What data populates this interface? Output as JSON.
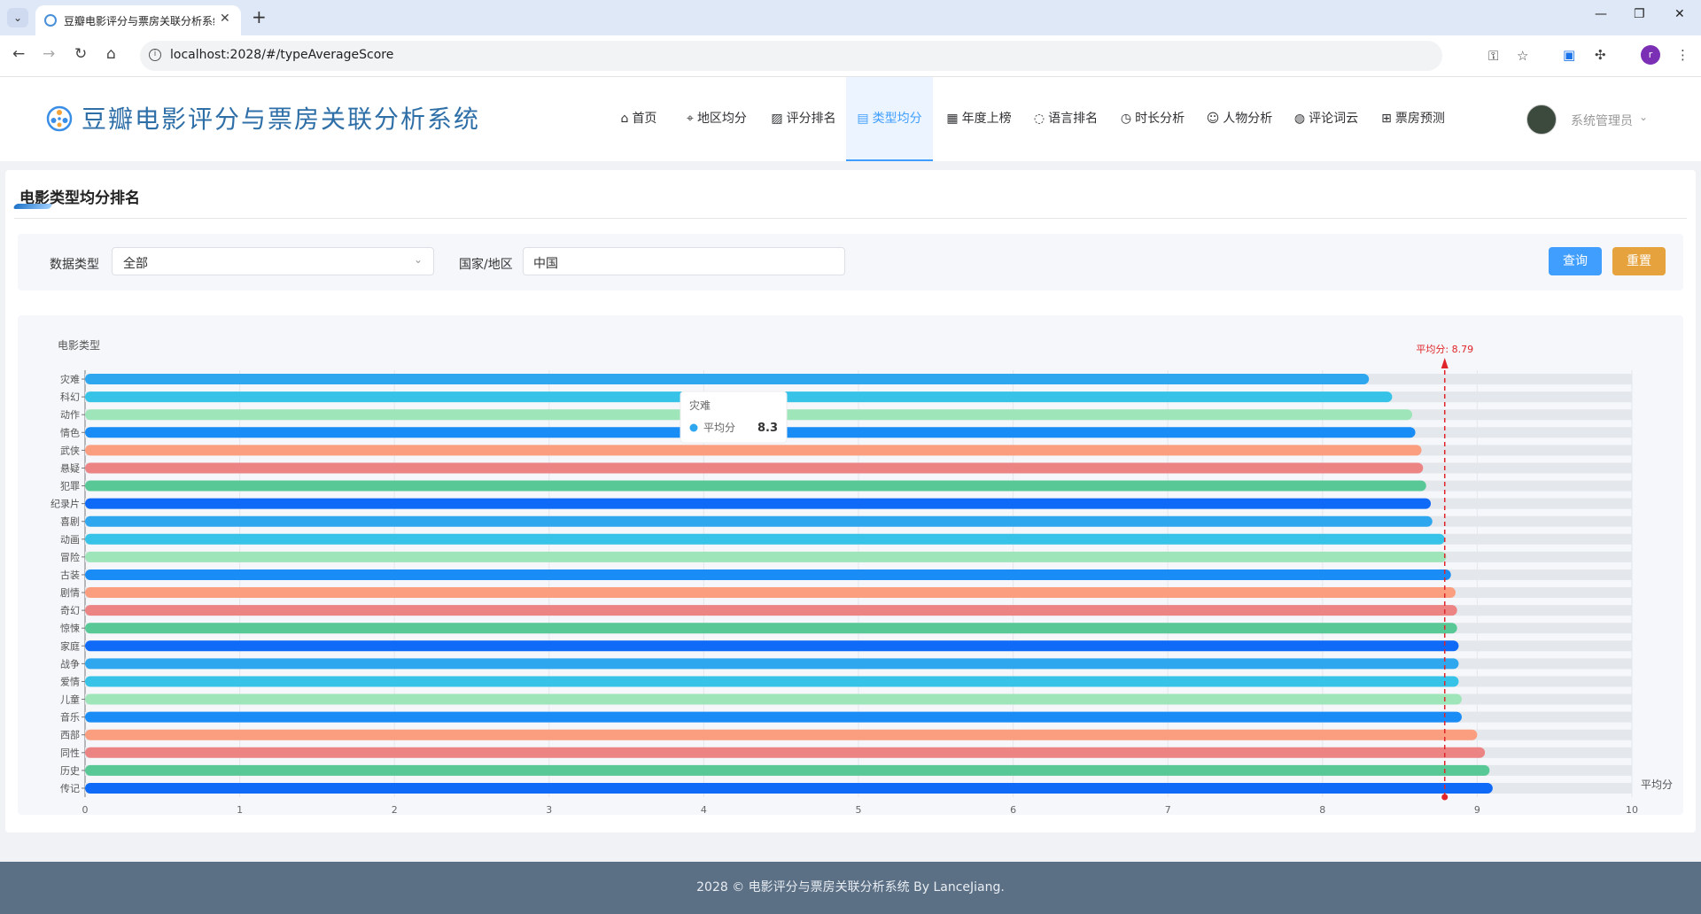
{
  "browser": {
    "tab_title": "豆瓣电影评分与票房关联分析系统",
    "url": "localhost:2028/#/typeAverageScore",
    "profile_initial": "r"
  },
  "header": {
    "app_title": "豆瓣电影评分与票房关联分析系统",
    "nav": [
      {
        "label": "首页",
        "icon": "home-icon"
      },
      {
        "label": "地区均分",
        "icon": "location-icon"
      },
      {
        "label": "评分排名",
        "icon": "chart-icon"
      },
      {
        "label": "类型均分",
        "icon": "doc-icon",
        "active": true
      },
      {
        "label": "年度上榜",
        "icon": "calendar-icon"
      },
      {
        "label": "语言排名",
        "icon": "chat-icon"
      },
      {
        "label": "时长分析",
        "icon": "timer-icon"
      },
      {
        "label": "人物分析",
        "icon": "user-icon"
      },
      {
        "label": "评论词云",
        "icon": "comment-icon"
      },
      {
        "label": "票房预测",
        "icon": "cart-icon"
      }
    ],
    "user_name": "系统管理员"
  },
  "page": {
    "title": "电影类型均分排名",
    "filters": {
      "data_type_label": "数据类型",
      "data_type_value": "全部",
      "region_label": "国家/地区",
      "region_value": "中国"
    },
    "query_button": "查询",
    "reset_button": "重置"
  },
  "chart_data": {
    "type": "bar",
    "orientation": "horizontal",
    "ylabel": "电影类型",
    "xlabel": "平均分",
    "xlim": [
      0,
      10
    ],
    "x_ticks": [
      "0",
      "1",
      "2",
      "3",
      "4",
      "5",
      "6",
      "7",
      "8",
      "9",
      "10"
    ],
    "categories": [
      "灾难",
      "科幻",
      "动作",
      "情色",
      "武侠",
      "悬疑",
      "犯罪",
      "纪录片",
      "喜剧",
      "动画",
      "冒险",
      "古装",
      "剧情",
      "奇幻",
      "惊悚",
      "家庭",
      "战争",
      "爱情",
      "儿童",
      "音乐",
      "西部",
      "同性",
      "历史",
      "传记"
    ],
    "series": [
      {
        "name": "平均分",
        "values": [
          8.3,
          8.45,
          8.58,
          8.6,
          8.64,
          8.65,
          8.67,
          8.7,
          8.71,
          8.79,
          8.8,
          8.83,
          8.86,
          8.87,
          8.87,
          8.88,
          8.88,
          8.88,
          8.9,
          8.9,
          9.0,
          9.05,
          9.08,
          9.1
        ]
      }
    ],
    "bar_colors": [
      "#2fa7ef",
      "#36c3e7",
      "#9ee6b9",
      "#1a8cf5",
      "#fb9e7f",
      "#ec8484",
      "#58c996",
      "#0e6af7"
    ],
    "mark_line": {
      "label": "平均分: 8.79",
      "value": 8.79,
      "color": "#e0252b"
    },
    "tooltip": {
      "category": "灾难",
      "series": "平均分",
      "value": "8.3"
    },
    "grid": true
  },
  "footer": {
    "text": "2028 © 电影评分与票房关联分析系统 By LanceJiang."
  }
}
